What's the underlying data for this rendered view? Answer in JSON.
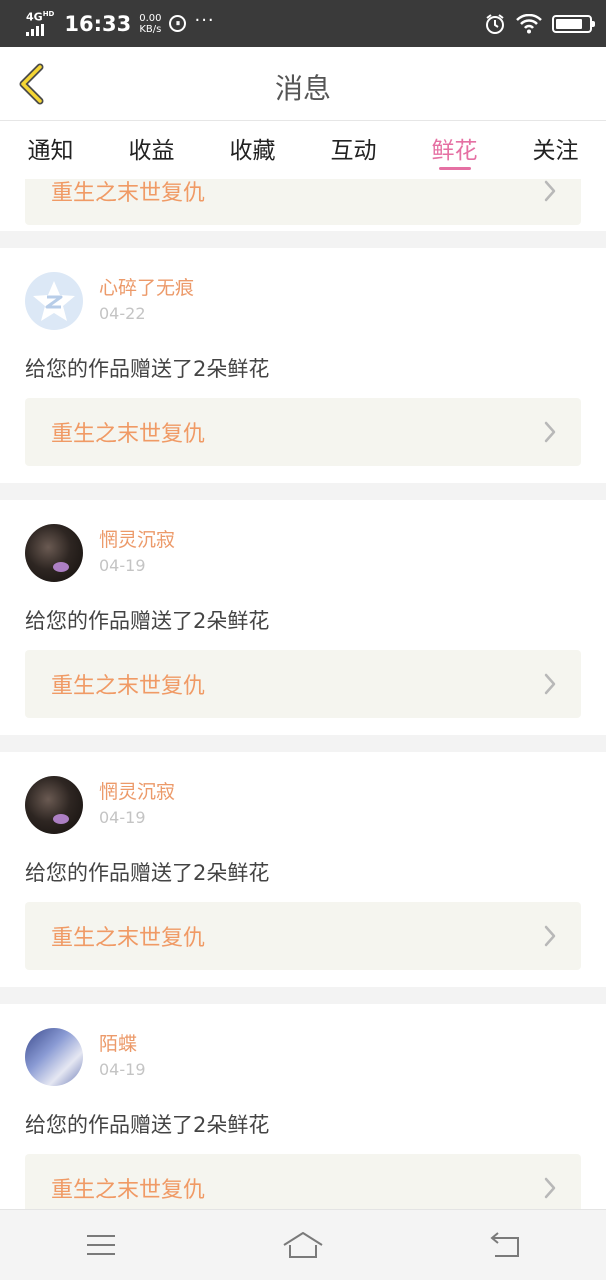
{
  "status_bar": {
    "network": "4G",
    "network_sup": "HD",
    "time": "16:33",
    "speed_value": "0.00",
    "speed_unit": "KB/s",
    "dots": "···"
  },
  "header": {
    "title": "消息"
  },
  "tabs": [
    {
      "label": "通知",
      "active": false
    },
    {
      "label": "收益",
      "active": false
    },
    {
      "label": "收藏",
      "active": false
    },
    {
      "label": "互动",
      "active": false
    },
    {
      "label": "鲜花",
      "active": true
    },
    {
      "label": "关注",
      "active": false
    }
  ],
  "partial_card": {
    "book_title": "重生之末世复仇"
  },
  "cards": [
    {
      "avatar": "qq-avatar",
      "username": "心碎了无痕",
      "date": "04-22",
      "message": "给您的作品赠送了2朵鲜花",
      "book_title": "重生之末世复仇"
    },
    {
      "avatar": "dark-avatar",
      "username": "惘灵沉寂",
      "date": "04-19",
      "message": "给您的作品赠送了2朵鲜花",
      "book_title": "重生之末世复仇"
    },
    {
      "avatar": "dark-avatar",
      "username": "惘灵沉寂",
      "date": "04-19",
      "message": "给您的作品赠送了2朵鲜花",
      "book_title": "重生之末世复仇"
    },
    {
      "avatar": "anime-avatar",
      "username": "陌蝶",
      "date": "04-19",
      "message": "给您的作品赠送了2朵鲜花",
      "book_title": "重生之末世复仇"
    }
  ],
  "colors": {
    "accent": "#e570a3",
    "username": "#ec9a6a",
    "book_title": "#f09a65"
  },
  "bottom_nav": [
    "menu-icon",
    "home-icon",
    "back-icon"
  ]
}
